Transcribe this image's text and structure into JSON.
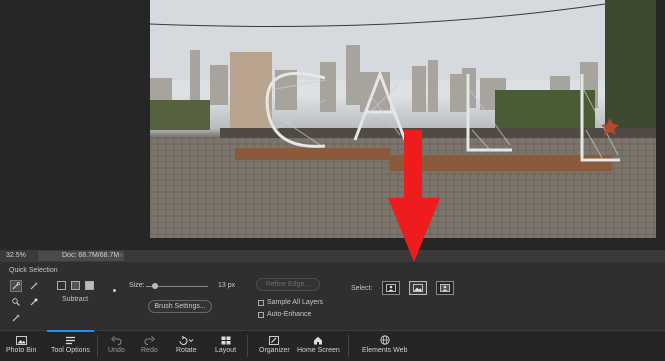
{
  "status": {
    "zoom": "32.5%",
    "doc": "Doc: 68.7M/68.7M"
  },
  "options": {
    "tool_title": "Quick Selection",
    "mode_label": "Subtract",
    "size_label": "Size:",
    "size_value": "13 px",
    "size_fraction": 0.15,
    "brush_settings": "Brush Settings...",
    "refine_edge": "Refine Edge...",
    "sample_all_layers": "Sample All Layers",
    "auto_enhance": "Auto-Enhance",
    "select_label": "Select:"
  },
  "taskbar": {
    "photo_bin": "Photo Bin",
    "tool_options": "Tool Options",
    "undo": "Undo",
    "redo": "Redo",
    "rotate": "Rotate",
    "layout": "Layout",
    "organizer": "Organizer",
    "home_screen": "Home Screen",
    "elements_web": "Elements Web"
  },
  "colors": {
    "accent": "#1e90ff",
    "annotation_arrow": "#ee1c1c"
  }
}
